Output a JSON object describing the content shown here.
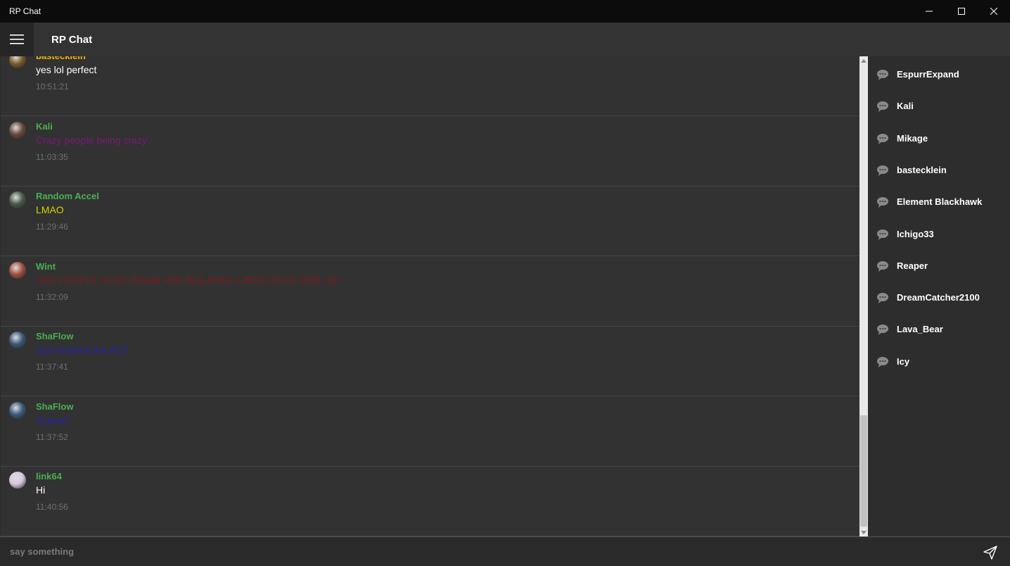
{
  "window": {
    "title": "RP Chat"
  },
  "appbar": {
    "title": "RP Chat"
  },
  "messages": [
    {
      "user": "bastecklein",
      "user_color": "#f5b800",
      "text": "yes lol perfect",
      "text_color": "#ffffff",
      "time": "10:51:21",
      "avatar_color": "#7a5a2a"
    },
    {
      "user": "Kali",
      "user_color": "#4caf50",
      "text": "Crazy people being crazy",
      "text_color": "#7a1a7a",
      "time": "11:03:35",
      "avatar_color": "#6a4a3a"
    },
    {
      "user": "Random Accel",
      "user_color": "#4caf50",
      "text": "LMAO",
      "text_color": "#d4d400",
      "time": "11:29:46",
      "avatar_color": "#4a5a4a"
    },
    {
      "user": "Wint",
      "user_color": "#4caf50",
      "text": "THE PEOPLE IN MY BRAIN ARE BUILDING A BEAUTIFUL FIRE rofl",
      "text_color": "#7a1a1a",
      "time": "11:32:09",
      "avatar_color": "#a05040"
    },
    {
      "user": "ShaFlow",
      "user_color": "#4caf50",
      "text": "Just finished the ACT",
      "text_color": "#2222aa",
      "time": "11:37:41",
      "avatar_color": "#3a5a7a"
    },
    {
      "user": "ShaFlow",
      "user_color": "#4caf50",
      "text": "Scared",
      "text_color": "#2222aa",
      "time": "11:37:52",
      "avatar_color": "#3a5a7a"
    },
    {
      "user": "link64",
      "user_color": "#4caf50",
      "text": "Hi",
      "text_color": "#ffffff",
      "time": "11:40:56",
      "avatar_color": "#d8c8e0"
    }
  ],
  "users": [
    {
      "name": "EspurrExpand"
    },
    {
      "name": "Kali"
    },
    {
      "name": "Mikage"
    },
    {
      "name": "bastecklein"
    },
    {
      "name": "Element Blackhawk"
    },
    {
      "name": "Ichigo33"
    },
    {
      "name": "Reaper"
    },
    {
      "name": "DreamCatcher2100"
    },
    {
      "name": "Lava_Bear"
    },
    {
      "name": "Icy"
    }
  ],
  "input": {
    "placeholder": "say something",
    "value": ""
  },
  "icons": {
    "menu": "hamburger-menu-icon",
    "user": "chat-bubble-icon",
    "send": "send-icon"
  }
}
